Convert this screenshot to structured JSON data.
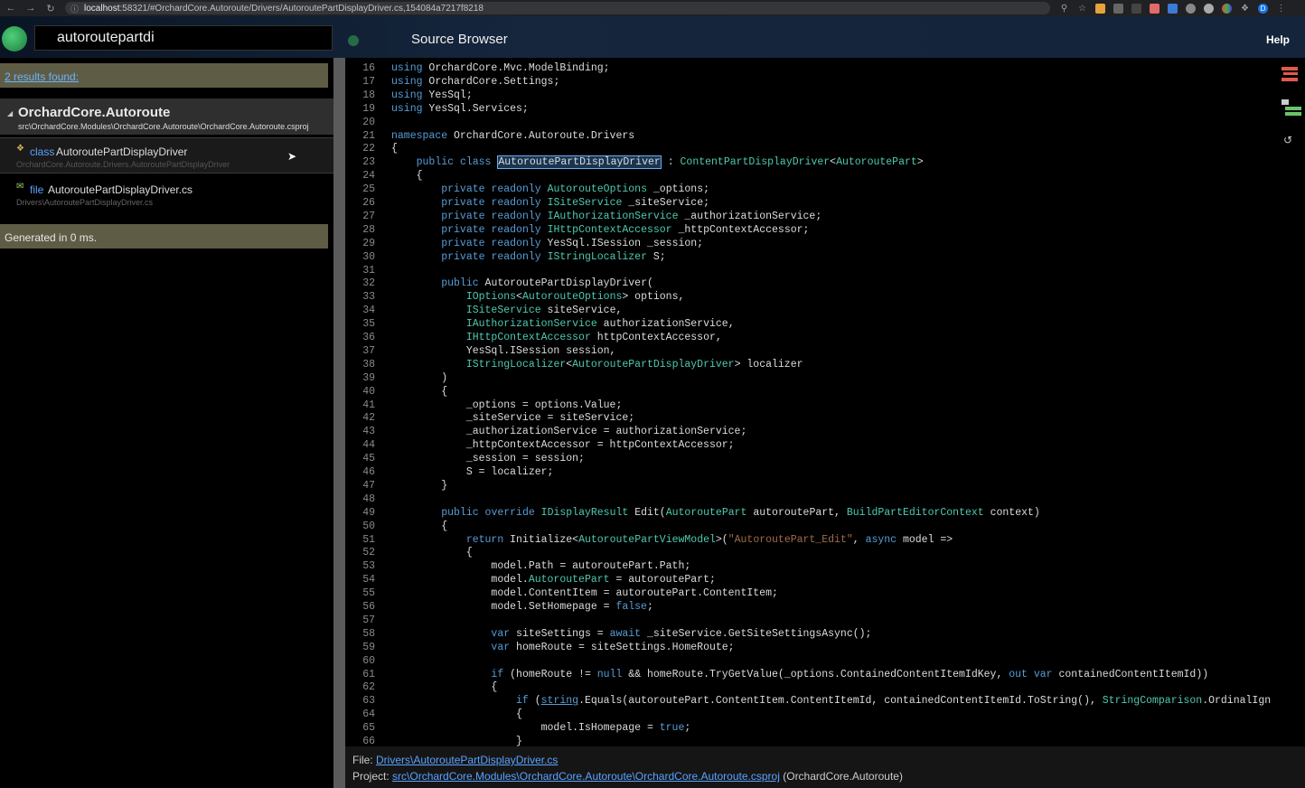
{
  "browser": {
    "url_host": "localhost",
    "url_rest": ":58321/#OrchardCore.Autoroute/Drivers/AutoroutePartDisplayDriver.cs,154084a7217f8218",
    "profile_initial": "D"
  },
  "header": {
    "search_value": "autoroutepartdi",
    "title": "Source Browser",
    "help_label": "Help"
  },
  "left": {
    "results_link": "2 results found:",
    "group_name": "OrchardCore.Autoroute",
    "group_path": "src\\OrchardCore.Modules\\OrchardCore.Autoroute\\OrchardCore.Autoroute.csproj",
    "items": [
      {
        "kind": "class",
        "name": "AutoroutePartDisplayDriver",
        "sub": "OrchardCore.Autoroute.Drivers.AutoroutePartDisplayDriver"
      },
      {
        "kind": "file",
        "name": "AutoroutePartDisplayDriver.cs",
        "sub": "Drivers\\AutoroutePartDisplayDriver.cs"
      }
    ],
    "generated": "Generated in 0 ms."
  },
  "code": {
    "lines": [
      {
        "n": "16",
        "t": "using OrchardCore.Mvc.ModelBinding;"
      },
      {
        "n": "17",
        "t": "using OrchardCore.Settings;"
      },
      {
        "n": "18",
        "t": "using YesSql;"
      },
      {
        "n": "19",
        "t": "using YesSql.Services;"
      },
      {
        "n": "20",
        "t": ""
      },
      {
        "n": "21",
        "t": "namespace OrchardCore.Autoroute.Drivers"
      },
      {
        "n": "22",
        "t": "{"
      },
      {
        "n": "23",
        "t": "    public class AutoroutePartDisplayDriver : ContentPartDisplayDriver<AutoroutePart>"
      },
      {
        "n": "24",
        "t": "    {"
      },
      {
        "n": "25",
        "t": "        private readonly AutorouteOptions _options;"
      },
      {
        "n": "26",
        "t": "        private readonly ISiteService _siteService;"
      },
      {
        "n": "27",
        "t": "        private readonly IAuthorizationService _authorizationService;"
      },
      {
        "n": "28",
        "t": "        private readonly IHttpContextAccessor _httpContextAccessor;"
      },
      {
        "n": "29",
        "t": "        private readonly YesSql.ISession _session;"
      },
      {
        "n": "30",
        "t": "        private readonly IStringLocalizer S;"
      },
      {
        "n": "31",
        "t": ""
      },
      {
        "n": "32",
        "t": "        public AutoroutePartDisplayDriver("
      },
      {
        "n": "33",
        "t": "            IOptions<AutorouteOptions> options,"
      },
      {
        "n": "34",
        "t": "            ISiteService siteService,"
      },
      {
        "n": "35",
        "t": "            IAuthorizationService authorizationService,"
      },
      {
        "n": "36",
        "t": "            IHttpContextAccessor httpContextAccessor,"
      },
      {
        "n": "37",
        "t": "            YesSql.ISession session,"
      },
      {
        "n": "38",
        "t": "            IStringLocalizer<AutoroutePartDisplayDriver> localizer"
      },
      {
        "n": "39",
        "t": "        )"
      },
      {
        "n": "40",
        "t": "        {"
      },
      {
        "n": "41",
        "t": "            _options = options.Value;"
      },
      {
        "n": "42",
        "t": "            _siteService = siteService;"
      },
      {
        "n": "43",
        "t": "            _authorizationService = authorizationService;"
      },
      {
        "n": "44",
        "t": "            _httpContextAccessor = httpContextAccessor;"
      },
      {
        "n": "45",
        "t": "            _session = session;"
      },
      {
        "n": "46",
        "t": "            S = localizer;"
      },
      {
        "n": "47",
        "t": "        }"
      },
      {
        "n": "48",
        "t": ""
      },
      {
        "n": "49",
        "t": "        public override IDisplayResult Edit(AutoroutePart autoroutePart, BuildPartEditorContext context)"
      },
      {
        "n": "50",
        "t": "        {"
      },
      {
        "n": "51",
        "t": "            return Initialize<AutoroutePartViewModel>(\"AutoroutePart_Edit\", async model =>"
      },
      {
        "n": "52",
        "t": "            {"
      },
      {
        "n": "53",
        "t": "                model.Path = autoroutePart.Path;"
      },
      {
        "n": "54",
        "t": "                model.AutoroutePart = autoroutePart;"
      },
      {
        "n": "55",
        "t": "                model.ContentItem = autoroutePart.ContentItem;"
      },
      {
        "n": "56",
        "t": "                model.SetHomepage = false;"
      },
      {
        "n": "57",
        "t": ""
      },
      {
        "n": "58",
        "t": "                var siteSettings = await _siteService.GetSiteSettingsAsync();"
      },
      {
        "n": "59",
        "t": "                var homeRoute = siteSettings.HomeRoute;"
      },
      {
        "n": "60",
        "t": ""
      },
      {
        "n": "61",
        "t": "                if (homeRoute != null && homeRoute.TryGetValue(_options.ContainedContentItemIdKey, out var containedContentItemId))"
      },
      {
        "n": "62",
        "t": "                {"
      },
      {
        "n": "63",
        "t": "                    if (string.Equals(autoroutePart.ContentItem.ContentItemId, containedContentItemId.ToString(), StringComparison.OrdinalIgn"
      },
      {
        "n": "64",
        "t": "                    {"
      },
      {
        "n": "65",
        "t": "                        model.IsHomepage = true;"
      },
      {
        "n": "66",
        "t": "                    }"
      }
    ]
  },
  "footer": {
    "file_label": "File:",
    "file_link": "Drivers\\AutoroutePartDisplayDriver.cs",
    "project_label": "Project:",
    "project_link": "src\\OrchardCore.Modules\\OrchardCore.Autoroute\\OrchardCore.Autoroute.csproj",
    "project_suffix": "(OrchardCore.Autoroute)"
  },
  "icons": {
    "back": "arrow-left-icon",
    "forward": "arrow-right-icon",
    "reload": "reload-icon",
    "class_item": "class-icon",
    "file_item": "file-icon"
  },
  "colors": {
    "keyword": "#569cd6",
    "type": "#4ec9b0",
    "string": "#a06a4a",
    "link": "#5aa2ff",
    "results_bar": "#5f5c45"
  }
}
